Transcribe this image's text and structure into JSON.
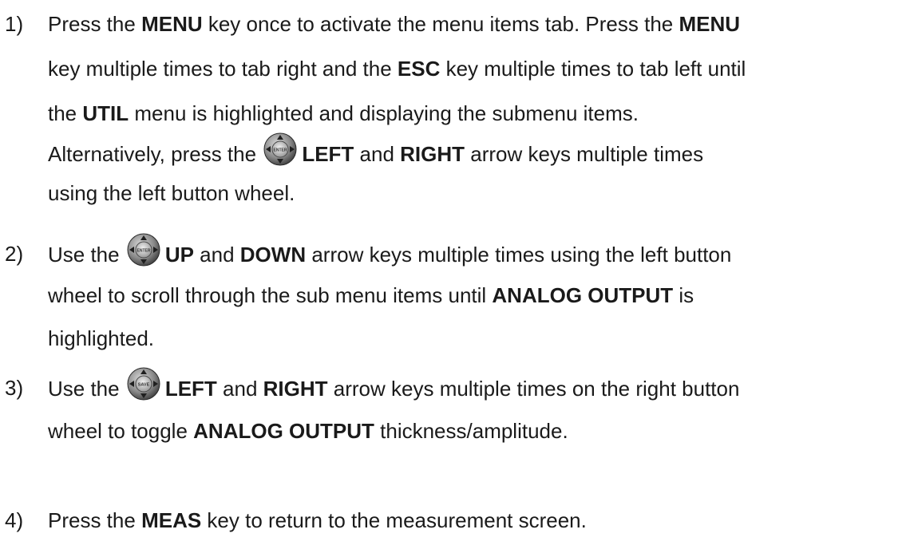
{
  "steps": [
    {
      "number": "1)",
      "lines": [
        [
          {
            "t": "Press the "
          },
          {
            "t": "MENU",
            "b": true
          },
          {
            "t": " key once to activate the menu items tab.  Press the "
          },
          {
            "t": "MENU",
            "b": true
          }
        ],
        [
          {
            "t": "key multiple times to tab right and the "
          },
          {
            "t": "ESC",
            "b": true
          },
          {
            "t": " key multiple times to tab left until"
          }
        ],
        [
          {
            "t": "the "
          },
          {
            "t": "UTIL",
            "b": true
          },
          {
            "t": " menu is highlighted and displaying the submenu items."
          }
        ],
        [
          {
            "t": "Alternatively, press the "
          },
          {
            "icon": "enter-wheel-icon",
            "label": "ENTER"
          },
          {
            "t": "LEFT",
            "b": true
          },
          {
            "t": " and "
          },
          {
            "t": "RIGHT",
            "b": true
          },
          {
            "t": " arrow keys multiple times"
          }
        ],
        [
          {
            "t": "using the left button wheel."
          }
        ]
      ]
    },
    {
      "number": "2)",
      "lines": [
        [
          {
            "t": "Use the "
          },
          {
            "icon": "enter-wheel-icon",
            "label": "ENTER"
          },
          {
            "t": "UP",
            "b": true
          },
          {
            "t": " and "
          },
          {
            "t": "DOWN",
            "b": true
          },
          {
            "t": " arrow keys multiple times using the left button"
          }
        ],
        [
          {
            "t": "wheel to scroll through the sub menu items until "
          },
          {
            "t": "ANALOG OUTPUT",
            "b": true
          },
          {
            "t": " is"
          }
        ],
        [
          {
            "t": "highlighted."
          }
        ]
      ]
    },
    {
      "number": "3)",
      "lines": [
        [
          {
            "t": "Use the "
          },
          {
            "icon": "right-wheel-icon",
            "label": "SAVE"
          },
          {
            "t": "LEFT",
            "b": true
          },
          {
            "t": " and "
          },
          {
            "t": "RIGHT",
            "b": true
          },
          {
            "t": " arrow keys multiple times on the right button"
          }
        ],
        [
          {
            "t": "wheel to toggle "
          },
          {
            "t": "ANALOG OUTPUT",
            "b": true
          },
          {
            "t": " thickness/amplitude."
          }
        ]
      ]
    },
    {
      "number": "4)",
      "lines": [
        [
          {
            "t": "Press the "
          },
          {
            "t": "MEAS",
            "b": true
          },
          {
            "t": " key to return to the measurement screen."
          }
        ]
      ]
    }
  ]
}
